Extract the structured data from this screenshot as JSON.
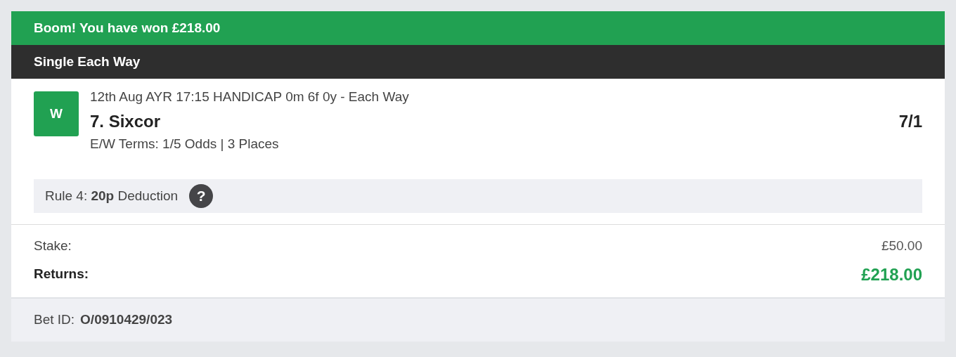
{
  "banner": {
    "text": "Boom! You have won £218.00"
  },
  "bet_type": "Single Each Way",
  "selection": {
    "result": "W",
    "race": "12th Aug AYR 17:15 HANDICAP 0m 6f 0y - Each Way",
    "runner": "7. Sixcor",
    "odds": "7/1",
    "terms": "E/W Terms: 1/5 Odds | 3 Places"
  },
  "rule4": {
    "text": "Rule 4: **20p** Deduction",
    "help": "?"
  },
  "summary": [
    {
      "label": "Stake:",
      "value": "£50.00",
      "kind": "plain"
    },
    {
      "label": "Returns:",
      "value": "£218.00",
      "kind": "total"
    }
  ],
  "footer": {
    "label": "Bet ID:",
    "value": "O/0910429/023"
  }
}
